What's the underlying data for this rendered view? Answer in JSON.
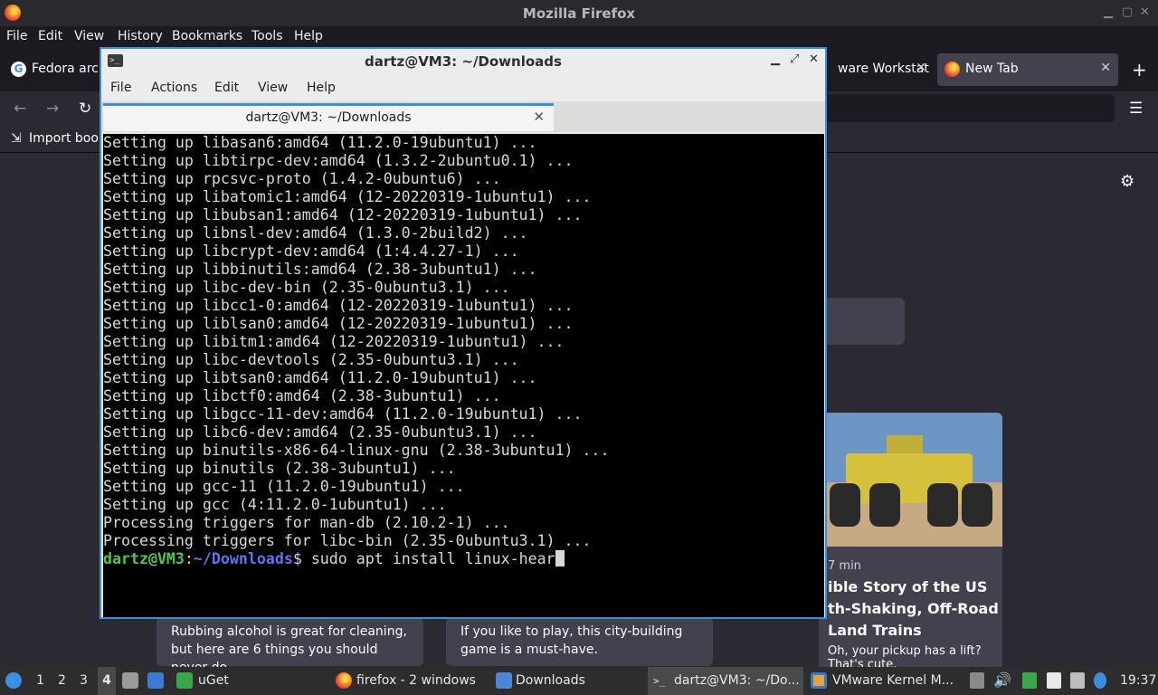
{
  "firefox": {
    "window_title": "Mozilla Firefox",
    "menu": [
      "File",
      "Edit",
      "View",
      "History",
      "Bookmarks",
      "Tools",
      "Help"
    ],
    "tabs": [
      {
        "label": "Fedora arch"
      },
      {
        "label": "ware Workstat"
      },
      {
        "label": "New Tab"
      }
    ],
    "new_tab_symbol": "+",
    "bookmarks_label": "Import book",
    "story": {
      "meta": "7 min",
      "title": "ible Story of the US th-Shaking, Off-Road Land Trains",
      "desc": "Oh, your pickup has a lift? That's cute."
    },
    "cards": [
      {
        "text": "Rubbing alcohol is great for cleaning, but here are 6 things you should never do."
      },
      {
        "text": "If you like to play, this city-building game is a must-have."
      }
    ]
  },
  "terminal": {
    "window_title": "dartz@VM3: ~/Downloads",
    "menu": [
      "File",
      "Actions",
      "Edit",
      "View",
      "Help"
    ],
    "tab_title": "dartz@VM3: ~/Downloads",
    "lines": [
      "Setting up libasan6:amd64 (11.2.0-19ubuntu1) ...",
      "Setting up libtirpc-dev:amd64 (1.3.2-2ubuntu0.1) ...",
      "Setting up rpcsvc-proto (1.4.2-0ubuntu6) ...",
      "Setting up libatomic1:amd64 (12-20220319-1ubuntu1) ...",
      "Setting up libubsan1:amd64 (12-20220319-1ubuntu1) ...",
      "Setting up libnsl-dev:amd64 (1.3.0-2build2) ...",
      "Setting up libcrypt-dev:amd64 (1:4.4.27-1) ...",
      "Setting up libbinutils:amd64 (2.38-3ubuntu1) ...",
      "Setting up libc-dev-bin (2.35-0ubuntu3.1) ...",
      "Setting up libcc1-0:amd64 (12-20220319-1ubuntu1) ...",
      "Setting up liblsan0:amd64 (12-20220319-1ubuntu1) ...",
      "Setting up libitm1:amd64 (12-20220319-1ubuntu1) ...",
      "Setting up libc-devtools (2.35-0ubuntu3.1) ...",
      "Setting up libtsan0:amd64 (11.2.0-19ubuntu1) ...",
      "Setting up libctf0:amd64 (2.38-3ubuntu1) ...",
      "Setting up libgcc-11-dev:amd64 (11.2.0-19ubuntu1) ...",
      "Setting up libc6-dev:amd64 (2.35-0ubuntu3.1) ...",
      "Setting up binutils-x86-64-linux-gnu (2.38-3ubuntu1) ...",
      "Setting up binutils (2.38-3ubuntu1) ...",
      "Setting up gcc-11 (11.2.0-19ubuntu1) ...",
      "Setting up gcc (4:11.2.0-1ubuntu1) ...",
      "Processing triggers for man-db (2.10.2-1) ...",
      "Processing triggers for libc-bin (2.35-0ubuntu3.1) ..."
    ],
    "prompt": {
      "user": "dartz@VM3",
      "sep": ":",
      "path": "~/Downloads",
      "symbol": "$ ",
      "command": "sudo apt install linux-hear"
    }
  },
  "taskbar": {
    "workspaces": [
      "1",
      "2",
      "3",
      "4"
    ],
    "items": [
      {
        "label": "uGet"
      },
      {
        "label": "firefox - 2 windows"
      },
      {
        "label": "Downloads"
      },
      {
        "label": "dartz@VM3: ~/Do..."
      },
      {
        "label": "VMware Kernel M..."
      }
    ],
    "clock": "19:37"
  }
}
